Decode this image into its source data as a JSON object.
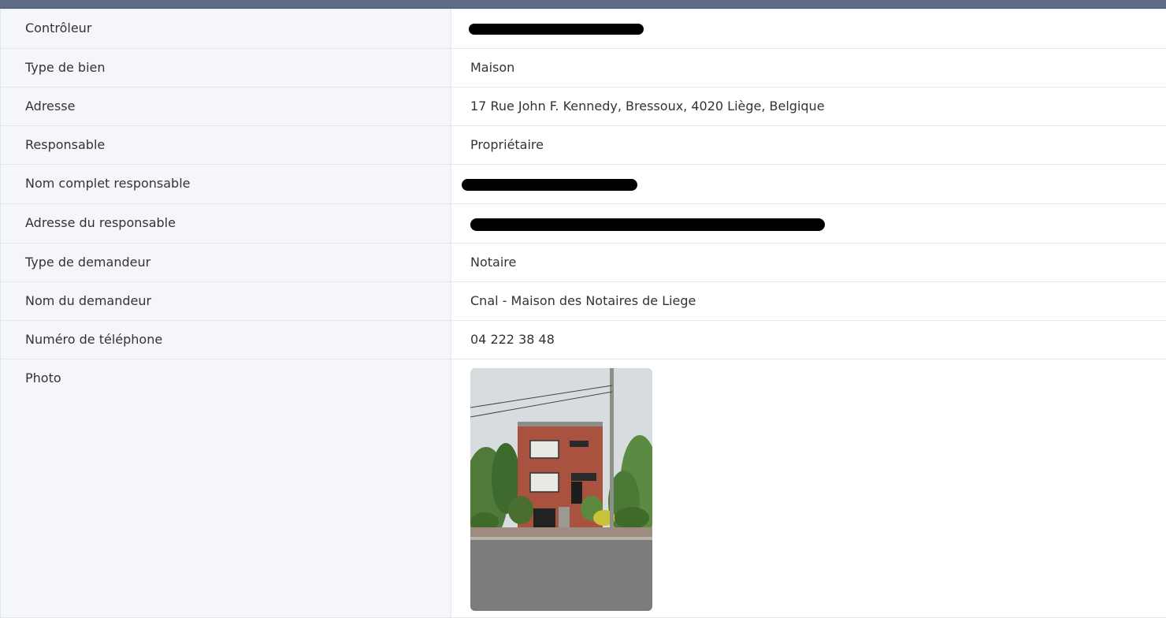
{
  "header": {
    "bar_color": "#5d6b86"
  },
  "rows": [
    {
      "label": "Contrôleur",
      "value": "",
      "redacted": true
    },
    {
      "label": "Type de bien",
      "value": "Maison"
    },
    {
      "label": "Adresse",
      "value": "17 Rue John F. Kennedy, Bressoux, 4020 Liège, Belgique"
    },
    {
      "label": "Responsable",
      "value": "Propriétaire"
    },
    {
      "label": "Nom complet responsable",
      "value": "",
      "redacted": true
    },
    {
      "label": "Adresse du responsable",
      "value": "",
      "redacted": true
    },
    {
      "label": "Type de demandeur",
      "value": "Notaire"
    },
    {
      "label": "Nom du demandeur",
      "value": "Cnal - Maison des Notaires de Liege"
    },
    {
      "label": "Numéro de téléphone",
      "value": "04 222 38 48"
    },
    {
      "label": "Photo",
      "value": ""
    }
  ],
  "photo": {
    "icon": "house-photo"
  }
}
